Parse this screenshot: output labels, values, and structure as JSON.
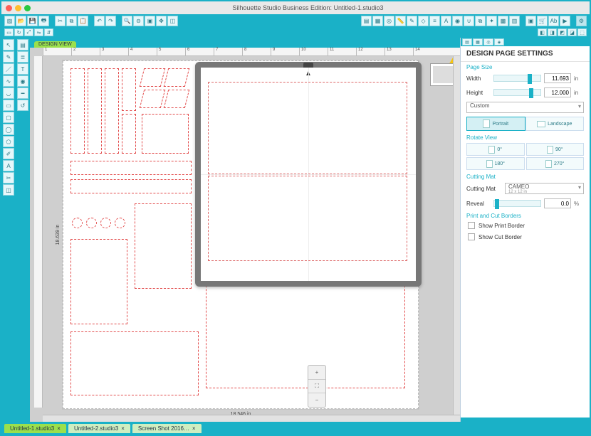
{
  "titlebar": {
    "title": "Silhouette Studio Business Edition: Untitled-1.studio3"
  },
  "top_tab": "DESIGN VIEW",
  "ruler_marks": [
    "1",
    "2",
    "3",
    "4",
    "5",
    "6",
    "7",
    "8",
    "9",
    "10",
    "11",
    "12",
    "13",
    "14"
  ],
  "dimensions": {
    "width_label": "18.546 in",
    "height_label": "18.639 in"
  },
  "doc_tabs": [
    {
      "label": "Untitled-1.studio3",
      "active": true
    },
    {
      "label": "Untitled-2.studio3",
      "active": false
    },
    {
      "label": "Screen Shot 2016…",
      "active": false
    }
  ],
  "panel": {
    "title": "DESIGN PAGE SETTINGS",
    "sections": {
      "page_size": "Page Size",
      "rotate_view": "Rotate View",
      "cutting_mat": "Cutting Mat",
      "print_cut": "Print and Cut Borders"
    },
    "width_label": "Width",
    "height_label": "Height",
    "width_value": "11.693",
    "height_value": "12.000",
    "unit": "in",
    "size_select": "Custom",
    "orientation": {
      "portrait": "Portrait",
      "landscape": "Landscape"
    },
    "rotate": {
      "r0": "0°",
      "r90": "90°",
      "r180": "180°",
      "r270": "270°"
    },
    "cutmat_label": "Cutting Mat",
    "cutmat_value": "CAMEO",
    "cutmat_sub": "12 x 12 in",
    "reveal_label": "Reveal",
    "reveal_value": "0.0",
    "reveal_unit": "%",
    "show_print": "Show Print Border",
    "show_cut": "Show Cut Border"
  },
  "zoom": {
    "plus": "+",
    "fit": "⛶",
    "minus": "−"
  }
}
